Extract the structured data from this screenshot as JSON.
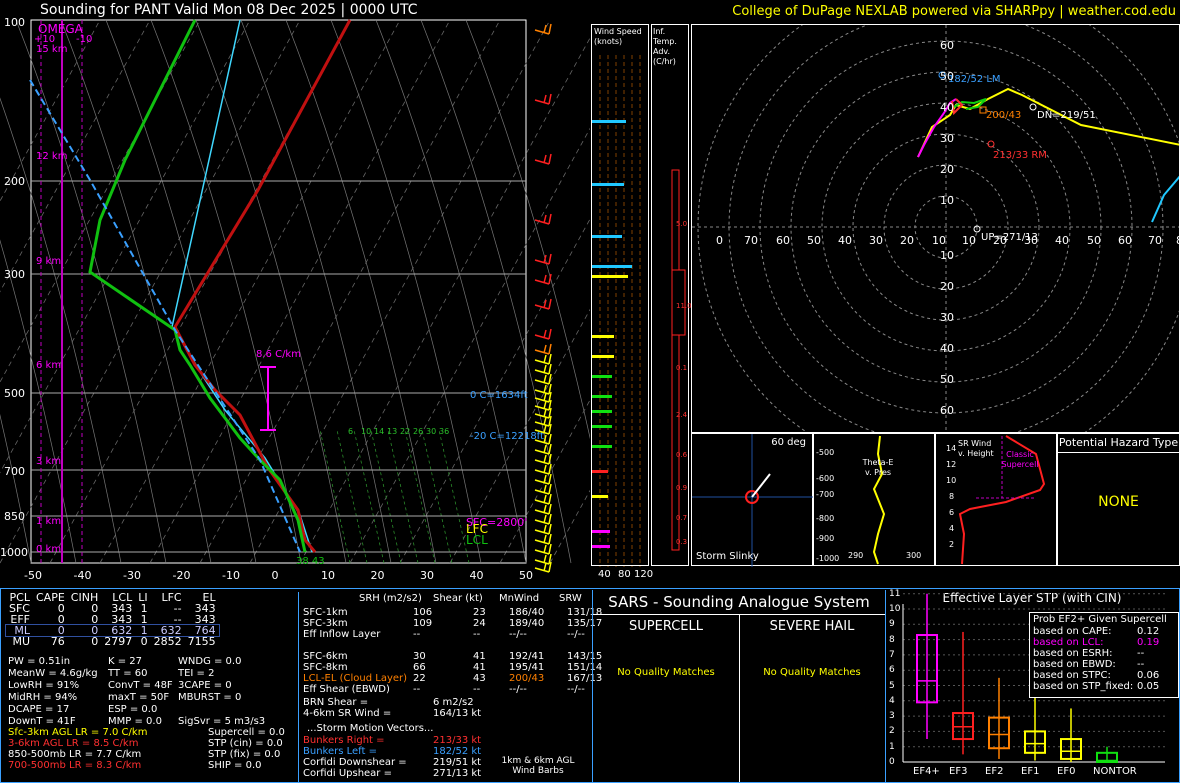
{
  "header": {
    "title": "Sounding for PANT Valid  Mon 08 Dec 2025 | 0000 UTC",
    "credit": "College of DuPage NEXLAB powered via SHARPpy | weather.cod.edu"
  },
  "colors": {
    "temp": "#d01010",
    "dewp": "#10c010",
    "wetbulb": "#20e0ff",
    "parcel": "#ff0000",
    "omega": "#ff00ff",
    "grid": "#808080",
    "accent": "#ffff00"
  },
  "skewt": {
    "pressure_ticks": [
      "100",
      "200",
      "300",
      "500",
      "700",
      "850",
      "1000"
    ],
    "temp_ticks": [
      "-50",
      "-40",
      "-30",
      "-20",
      "-10",
      "0",
      "10",
      "20",
      "30",
      "40",
      "50"
    ],
    "height_labels": [
      "15 km",
      "12 km",
      "9 km",
      "6 km",
      "3 km",
      "1 km",
      "0 km"
    ],
    "omega_label": "OMEGA",
    "omega_ticks": [
      "+10",
      "-10"
    ],
    "lapse_label": "8.6 C/km",
    "wetbulb_zero": "0 C=1634ft",
    "m20_label": "-20 C=12218ft",
    "lfc_label": "LFC",
    "lcl_label": "LCL",
    "sfc_label": "SFC=2800'",
    "sfc_temps": "38 43",
    "mixing_ratios": [
      "6",
      "10",
      "14",
      "13",
      "22",
      "26",
      "30",
      "36"
    ]
  },
  "wind_speed_panel": {
    "title": "Wind Speed (knots)",
    "ticks": [
      "40",
      "80",
      "120"
    ]
  },
  "temp_adv_panel": {
    "title": "Inf. Temp. Adv. (C/hr)",
    "values": [
      "5.0",
      "11.0",
      "0.1",
      "2.4",
      "0.6",
      "0.9",
      "0.7",
      "0.3"
    ]
  },
  "hodograph": {
    "rings": [
      "10",
      "20",
      "30",
      "40",
      "50",
      "60",
      "70",
      "80"
    ],
    "y_ticks": [
      "60",
      "50",
      "40",
      "30",
      "20",
      "10",
      "10",
      "20",
      "30",
      "40",
      "50",
      "60"
    ],
    "x_ticks": [
      "0",
      "70",
      "60",
      "50",
      "40",
      "30",
      "20",
      "10",
      "10",
      "20",
      "30",
      "40",
      "50",
      "60",
      "70",
      "8"
    ],
    "labels": {
      "lm": "182/52 LM",
      "mean": "200/43",
      "dn": "DN=219/51",
      "rm": "213/33 RM",
      "up": "UP=271/13"
    }
  },
  "storm_slinky": {
    "title": "Storm Slinky",
    "deg": "60 deg"
  },
  "theta_panel": {
    "title": "Theta-E v. Pres",
    "ticks": [
      "-500",
      "-600",
      "-700",
      "-800",
      "-900",
      "-1000"
    ],
    "x": [
      "290",
      "300"
    ]
  },
  "srwind_panel": {
    "title": "SR Wind v. Height",
    "ticks": [
      "14",
      "12",
      "10",
      "8",
      "6",
      "4",
      "2"
    ],
    "classic": "Classic Supercell"
  },
  "hazard": {
    "title": "Potential Hazard Type",
    "value": "NONE"
  },
  "params": {
    "headers": [
      "PCL",
      "CAPE",
      "CINH",
      "LCL",
      "LI",
      "LFC",
      "EL"
    ],
    "rows": [
      [
        "SFC",
        "0",
        "0",
        "343",
        "1",
        "--",
        "343"
      ],
      [
        "EFF",
        "0",
        "0",
        "343",
        "1",
        "--",
        "343"
      ],
      [
        "ML",
        "0",
        "0",
        "632",
        "1",
        "632",
        "764"
      ],
      [
        "MU",
        "76",
        "0",
        "2797",
        "0",
        "2852",
        "7155"
      ]
    ],
    "misc": [
      [
        "PW = 0.51in",
        "K = 27",
        "WNDG = 0.0"
      ],
      [
        "MeanW = 4.6g/kg",
        "TT = 60",
        "TEI = 2"
      ],
      [
        "LowRH = 91%",
        "ConvT = 48F",
        "3CAPE = 0"
      ],
      [
        "MidRH = 94%",
        "maxT = 50F",
        "MBURST = 0"
      ],
      [
        "DCAPE = 17",
        "ESP = 0.0",
        ""
      ],
      [
        "DownT = 41F",
        "MMP = 0.0",
        "SigSvr = 5 m3/s3"
      ]
    ],
    "lapse": [
      {
        "t": "Sfc-3km AGL LR = 7.0 C/km",
        "c": "#ffff00"
      },
      {
        "t": "3-6km AGL LR = 8.5 C/km",
        "c": "#ff3030"
      },
      {
        "t": "850-500mb LR = 7.7 C/km",
        "c": "#ffffff"
      },
      {
        "t": "700-500mb LR = 8.3 C/km",
        "c": "#ff3030"
      }
    ],
    "composites": [
      "Supercell = 0.0",
      "STP (cin) = 0.0",
      "STP (fix) = 0.0",
      "SHIP = 0.0"
    ]
  },
  "kinematics": {
    "headers": [
      "SRH (m2/s2)",
      "Shear (kt)",
      "MnWind",
      "SRW"
    ],
    "rows": [
      [
        "SFC-1km",
        "106",
        "23",
        "186/40",
        "131/18"
      ],
      [
        "SFC-3km",
        "109",
        "24",
        "189/40",
        "135/17"
      ],
      [
        "Eff Inflow Layer",
        "--",
        "--",
        "--/--",
        "--/--"
      ],
      [
        "",
        "",
        " ",
        "",
        ""
      ],
      [
        "SFC-6km",
        "30",
        "41",
        "192/41",
        "143/15"
      ],
      [
        "SFC-8km",
        "66",
        "41",
        "195/41",
        "151/14"
      ],
      [
        "LCL-EL (Cloud Layer)",
        "22",
        "43",
        "200/43",
        "167/13"
      ],
      [
        "Eff Shear (EBWD)",
        "--",
        "--",
        "--/--",
        "--/--"
      ]
    ],
    "brn": [
      "BRN Shear =",
      "6 m2/s2"
    ],
    "srwind46": [
      "4-6km SR Wind =",
      "164/13 kt"
    ],
    "motion_title": "...Storm Motion Vectors...",
    "motion": [
      [
        "Bunkers Right =",
        "213/33 kt",
        "#ff3030"
      ],
      [
        "Bunkers Left =",
        "182/52 kt",
        "#3aa0ff"
      ],
      [
        "Corfidi Downshear =",
        "219/51 kt",
        "#ffffff"
      ],
      [
        "Corfidi Upshear =",
        "271/13 kt",
        "#ffffff"
      ]
    ],
    "barb_caption": "1km & 6km AGL Wind Barbs"
  },
  "sars": {
    "title": "SARS - Sounding Analogue System",
    "supercell": "SUPERCELL",
    "hail": "SEVERE HAIL",
    "supercell_val": "No Quality Matches",
    "hail_val": "No Quality Matches"
  },
  "stp": {
    "title": "Effective Layer STP (with CIN)",
    "yticks": [
      "11",
      "10",
      "9",
      "8",
      "7",
      "6",
      "5",
      "4",
      "3",
      "2",
      "1",
      "0"
    ],
    "cats": [
      "EF4+",
      "EF3",
      "EF2",
      "EF1",
      "EF0",
      "NONTOR"
    ],
    "box_title": "Prob EF2+ Given Supercell",
    "probs": [
      [
        "based on CAPE:",
        "0.12",
        "#ffffff"
      ],
      [
        "based on LCL:",
        "0.19",
        "#ff00ff"
      ],
      [
        "based on ESRH:",
        "--",
        "#ffffff"
      ],
      [
        "based on EBWD:",
        "--",
        "#ffffff"
      ],
      [
        "based on STPC:",
        "0.06",
        "#ffffff"
      ],
      [
        "based on STP_fixed:",
        "0.05",
        "#ffffff"
      ]
    ]
  }
}
